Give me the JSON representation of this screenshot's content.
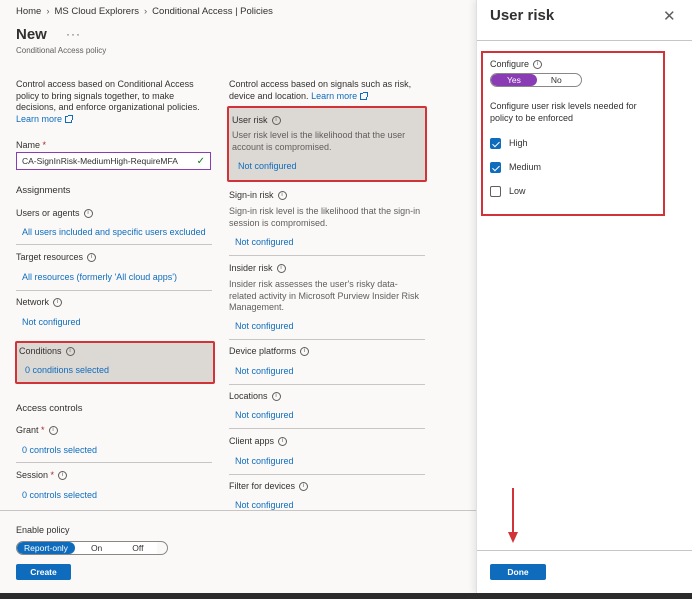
{
  "breadcrumb": [
    "Home",
    "MS Cloud Explorers",
    "Conditional Access | Policies"
  ],
  "header": {
    "title": "New",
    "more": "···",
    "subtitle": "Conditional Access policy"
  },
  "left": {
    "intro": "Control access based on Conditional Access policy to bring signals together, to make decisions, and enforce organizational policies.",
    "learn_more": "Learn more",
    "name_label": "Name",
    "required_mark": "*",
    "name_value": "CA-SignInRisk-MediumHigh-RequireMFA",
    "assignments_heading": "Assignments",
    "users_label": "Users or agents",
    "users_value": "All users included and specific users excluded",
    "target_label": "Target resources",
    "target_value": "All resources (formerly 'All cloud apps')",
    "network_label": "Network",
    "network_value": "Not configured",
    "conditions_label": "Conditions",
    "conditions_value": "0 conditions selected",
    "access_heading": "Access controls",
    "grant_label": "Grant",
    "grant_value": "0 controls selected",
    "session_label": "Session",
    "session_value": "0 controls selected"
  },
  "middle": {
    "intro": "Control access based on signals such as risk, device and location.",
    "learn_more": "Learn more",
    "user_risk_label": "User risk",
    "user_risk_desc": "User risk level is the likelihood that the user account is compromised.",
    "user_risk_value": "Not configured",
    "signin_risk_label": "Sign-in risk",
    "signin_risk_desc": "Sign-in risk level is the likelihood that the sign-in session is compromised.",
    "signin_risk_value": "Not configured",
    "insider_risk_label": "Insider risk",
    "insider_risk_desc": "Insider risk assesses the user's risky data-related activity in Microsoft Purview Insider Risk Management.",
    "insider_risk_value": "Not configured",
    "device_label": "Device platforms",
    "device_value": "Not configured",
    "locations_label": "Locations",
    "locations_value": "Not configured",
    "client_label": "Client apps",
    "client_value": "Not configured",
    "filter_label": "Filter for devices",
    "filter_value": "Not configured"
  },
  "footer": {
    "enable_label": "Enable policy",
    "options": [
      "Report-only",
      "On",
      "Off"
    ],
    "selected": "Report-only",
    "create": "Create"
  },
  "panel": {
    "title": "User risk",
    "close": "✕",
    "configure_label": "Configure",
    "configure_options": [
      "Yes",
      "No"
    ],
    "configure_selected": "Yes",
    "instruction": "Configure user risk levels needed for policy to be enforced",
    "levels": [
      {
        "label": "High",
        "checked": true
      },
      {
        "label": "Medium",
        "checked": true
      },
      {
        "label": "Low",
        "checked": false
      }
    ],
    "done": "Done"
  },
  "colors": {
    "accent": "#0f6cbd",
    "highlight": "#d13438",
    "toggle_yes": "#8a3cb5"
  }
}
